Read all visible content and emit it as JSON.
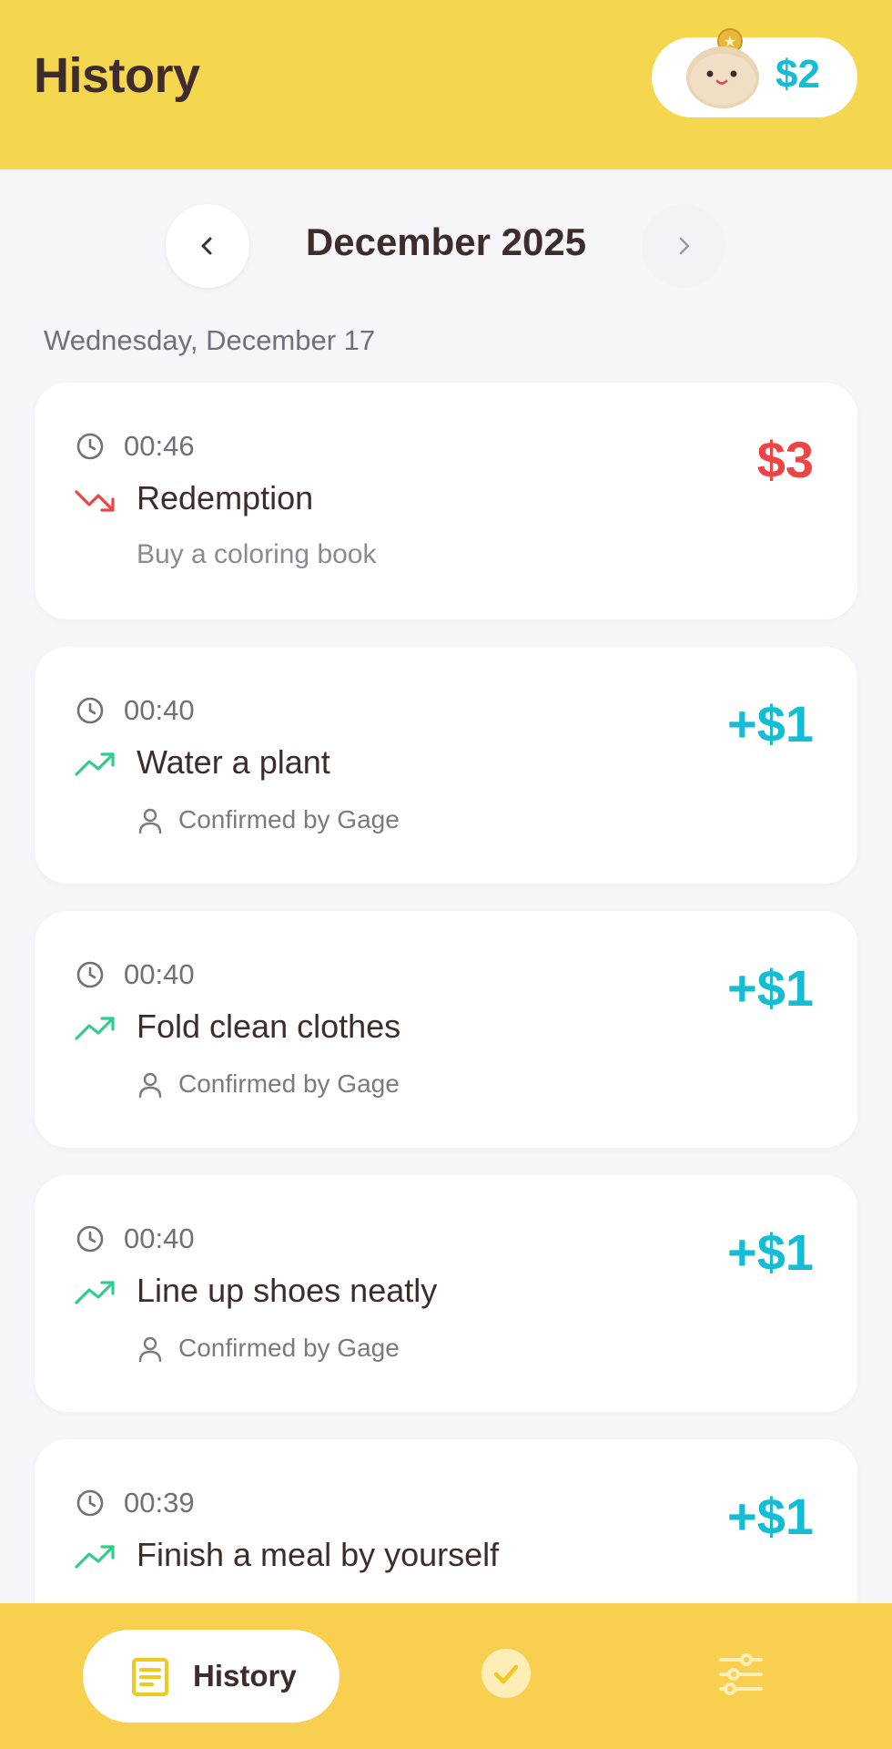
{
  "header": {
    "title": "History",
    "balance": "$2",
    "mascot_icon": "coin-purse-mascot-icon"
  },
  "month_nav": {
    "label": "December 2025",
    "prev_icon": "chevron-left-icon",
    "next_icon": "chevron-right-icon"
  },
  "date_heading": "Wednesday, December 17",
  "entries": [
    {
      "time": "00:46",
      "title": "Redemption",
      "subtitle": "Buy a coloring book",
      "amount": "$3",
      "type": "redemption"
    },
    {
      "time": "00:40",
      "title": "Water a plant",
      "confirm": "Confirmed by Gage",
      "amount": "+$1",
      "type": "earning"
    },
    {
      "time": "00:40",
      "title": "Fold clean clothes",
      "confirm": "Confirmed by Gage",
      "amount": "+$1",
      "type": "earning"
    },
    {
      "time": "00:40",
      "title": "Line up shoes neatly",
      "confirm": "Confirmed by Gage",
      "amount": "+$1",
      "type": "earning"
    },
    {
      "time": "00:39",
      "title": "Finish a meal by yourself",
      "amount": "+$1",
      "type": "earning"
    }
  ],
  "bottom_nav": {
    "history_label": "History",
    "history_icon": "document-list-icon",
    "tasks_icon": "check-circle-icon",
    "settings_icon": "sliders-icon"
  },
  "colors": {
    "header_bg": "#f5d74f",
    "nav_bg": "#f8cf4f",
    "positive": "#14bcd4",
    "negative": "#ee4444",
    "trend_up": "#2ecf8a",
    "text_dark": "#3e2c2c"
  }
}
